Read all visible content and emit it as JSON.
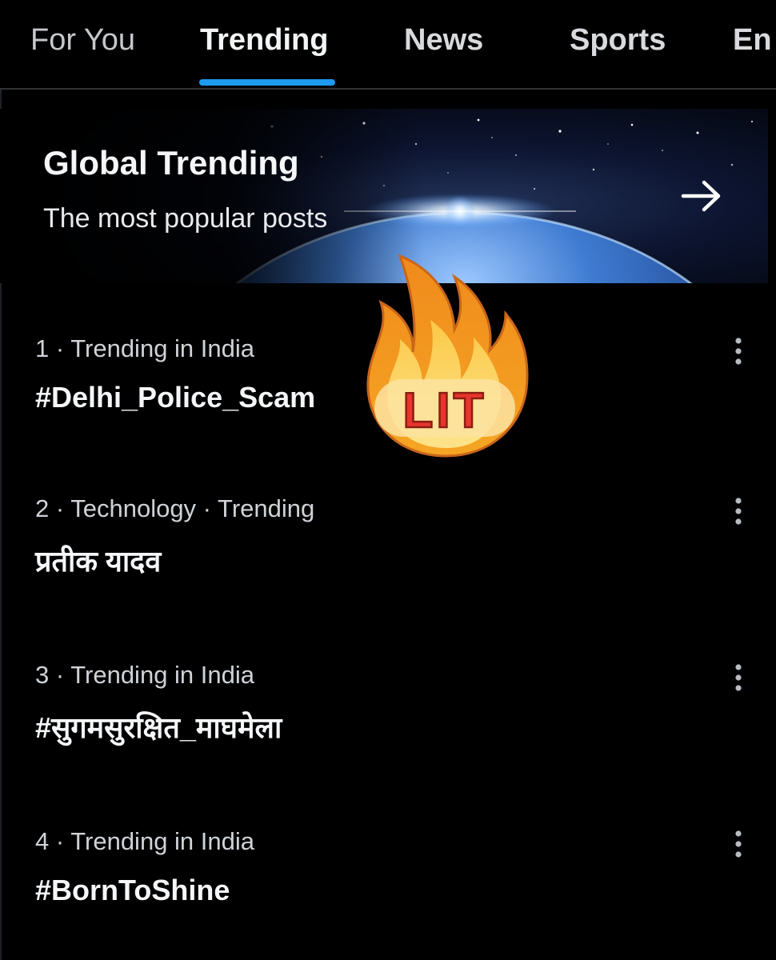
{
  "tabs": [
    {
      "label": "For You",
      "active": false
    },
    {
      "label": "Trending",
      "active": true
    },
    {
      "label": "News",
      "active": false
    },
    {
      "label": "Sports",
      "active": false
    },
    {
      "label": "En",
      "active": false
    }
  ],
  "banner": {
    "title": "Global Trending",
    "subtitle": "The most popular posts",
    "arrow_icon": "arrow-right-icon"
  },
  "trends": [
    {
      "meta": "1 · Trending in India",
      "name": "#Delhi_Police_Scam"
    },
    {
      "meta": "2 · Technology · Trending",
      "name": "प्रतीक यादव"
    },
    {
      "meta": "3 · Trending in India",
      "name": "#सुगमसुरक्षित_माघमेला"
    },
    {
      "meta": "4 · Trending in India",
      "name": "#BornToShine"
    }
  ],
  "sticker": {
    "text": "LIT",
    "icon": "fire-icon"
  },
  "colors": {
    "background": "#000000",
    "accent": "#1d9bf0",
    "text_primary": "#f4f6f8",
    "text_secondary": "#cfd3d7",
    "fire_outer": "#f5a623",
    "fire_inner": "#fcd96a",
    "sticker_text": "#e8352d"
  }
}
